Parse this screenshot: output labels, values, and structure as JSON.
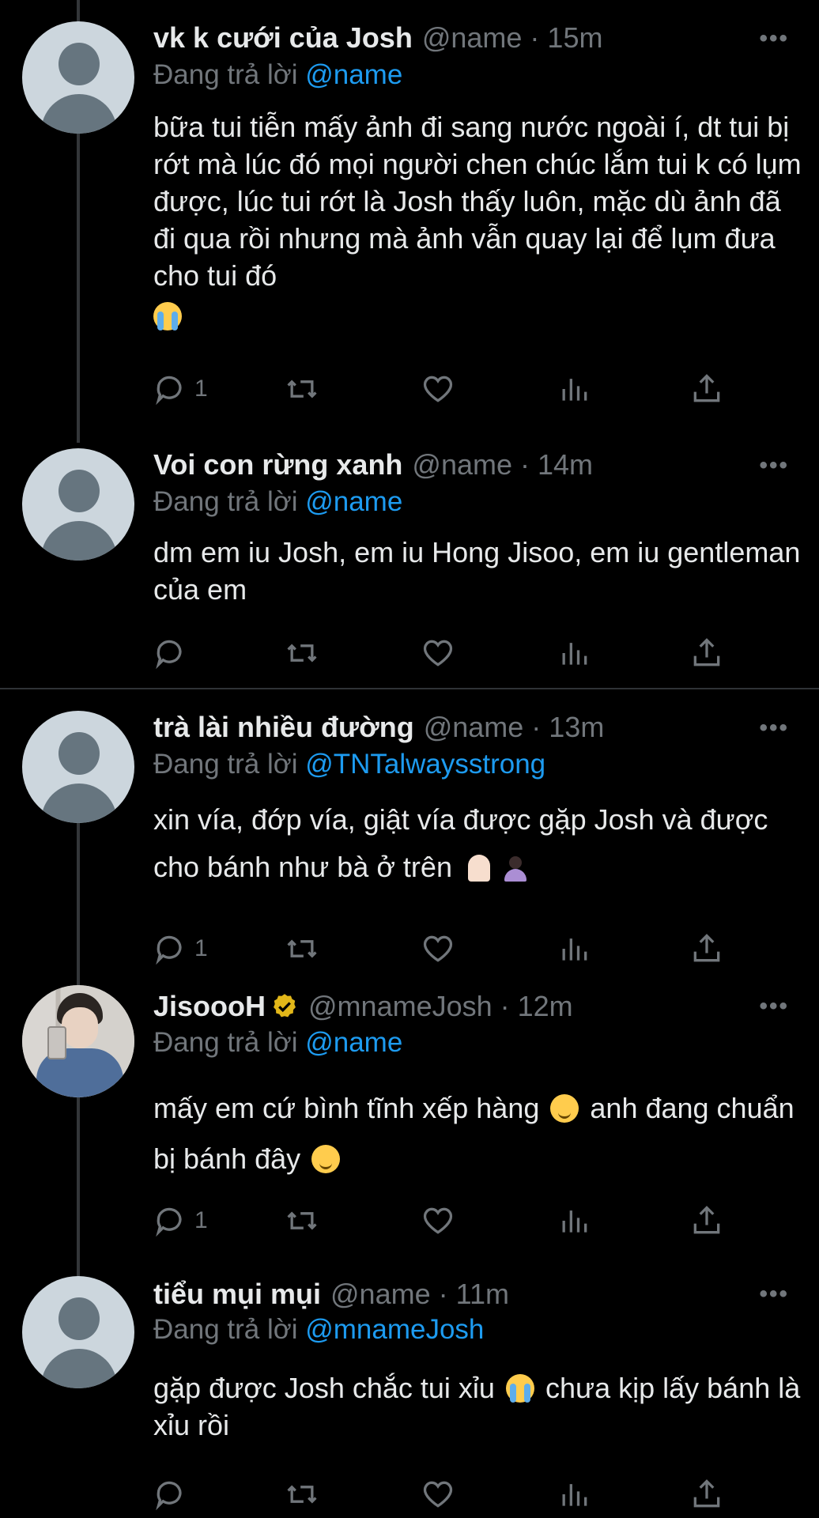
{
  "tweets": [
    {
      "name": "vk k cưới của Josh",
      "handle_time": "@name · 15m",
      "replying_prefix": "Đang trả lời",
      "replying_to": "@name",
      "text": "bữa tui tiễn mấy ảnh đi sang nước ngoài í, dt tui bị rớt mà lúc đó mọi người chen chúc lắm tui k có lụm được, lúc tui rớt là Josh thấy luôn, mặc dù ảnh đã đi qua rồi nhưng mà ảnh vẫn quay lại để lụm đưa cho tui đó",
      "emojis": [
        "loudly-crying-face-emoji"
      ],
      "reply_count": "1"
    },
    {
      "name": "Voi con rừng xanh",
      "handle_time": "@name · 14m",
      "replying_prefix": "Đang trả lời",
      "replying_to": "@name",
      "text": "dm em iu Josh, em iu Hong Jisoo, em iu gentleman của em",
      "reply_count": ""
    },
    {
      "name": "trà lài nhiều đường",
      "handle_time": "@name · 13m",
      "replying_prefix": "Đang trả lời",
      "replying_to": "@TNTalwaysstrong",
      "text": "xin vía, đớp vía, giật vía được gặp Josh và được cho bánh như bà ở trên",
      "emojis": [
        "folded-hands-emoji",
        "person-emoji"
      ],
      "reply_count": "1"
    },
    {
      "name": "JisoooH",
      "verified": true,
      "handle_time": "@mnameJosh · 12m",
      "replying_prefix": "Đang trả lời",
      "replying_to": "@name",
      "text_part1": "mấy em cứ bình tĩnh xếp hàng",
      "text_part2": "anh đang chuẩn bị bánh đây",
      "emojis": [
        "relieved-face-emoji",
        "relieved-face-emoji"
      ],
      "reply_count": "1"
    },
    {
      "name": "tiểu mụi mụi",
      "handle_time": "@name · 11m",
      "replying_prefix": "Đang trả lời",
      "replying_to": "@mnameJosh",
      "text_part1": "gặp được Josh chắc tui xỉu",
      "text_part2": "chưa kịp lấy bánh là xỉu rồi",
      "emojis": [
        "loudly-crying-face-emoji"
      ],
      "reply_count": ""
    }
  ],
  "more_label": "•••",
  "colors": {
    "background": "#000000",
    "text": "#e7e9ea",
    "secondary": "#71767b",
    "link": "#1d9bf0",
    "thread_line": "#333639",
    "verified": "#e2b719"
  }
}
